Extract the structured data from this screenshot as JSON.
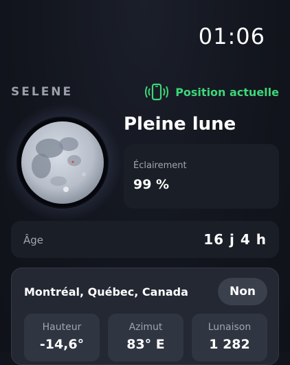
{
  "status": {
    "time": "01:06"
  },
  "header": {
    "brand": "SELENE",
    "location_label": "Position actuelle",
    "location_icon": "phone-location-icon",
    "accent": "#3dd67a"
  },
  "moon": {
    "phase_name": "Pleine lune",
    "illumination_label": "Éclairement",
    "illumination_value": "99 %"
  },
  "age": {
    "label": "Âge",
    "value": "16 j 4 h"
  },
  "city": {
    "name": "Montréal, Québec, Canada",
    "toggle_label": "Non",
    "stats": [
      {
        "label": "Hauteur",
        "value": "-14,6°"
      },
      {
        "label": "Azimut",
        "value": "83° E"
      },
      {
        "label": "Lunaison",
        "value": "1 282"
      }
    ]
  }
}
